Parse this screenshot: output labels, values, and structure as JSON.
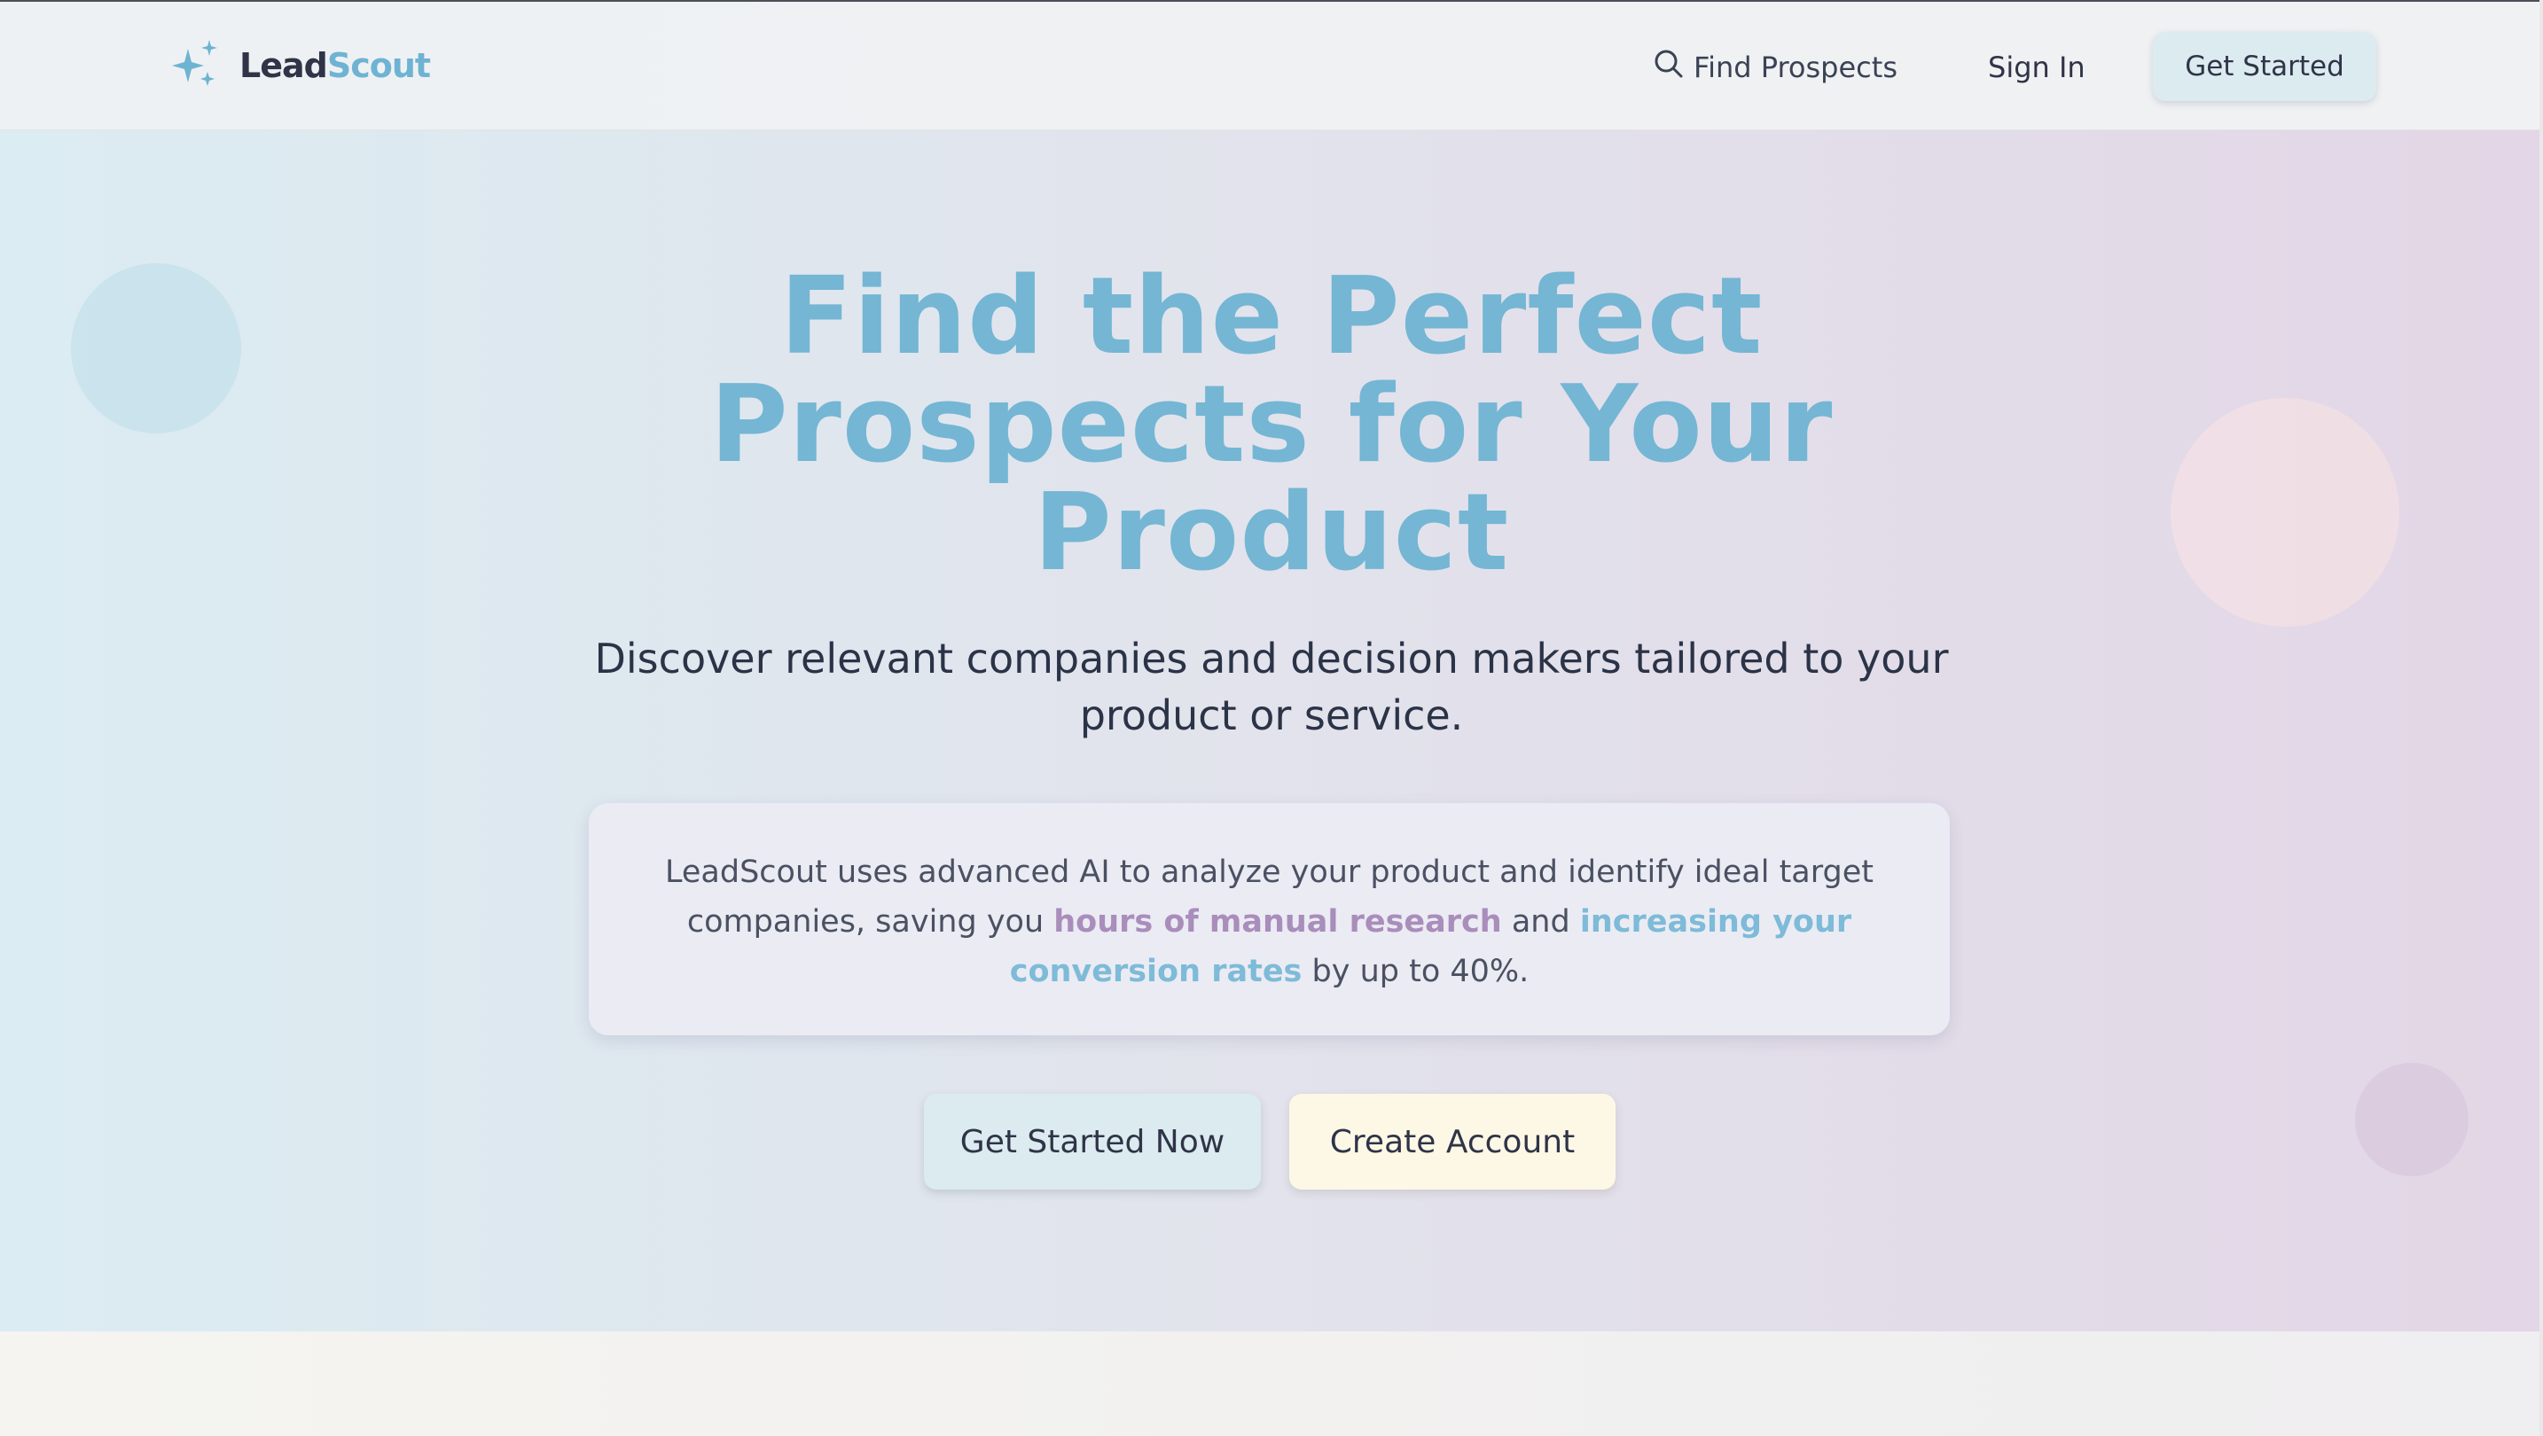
{
  "brand": {
    "name_part1": "Lead",
    "name_part2": "Scout",
    "icon": "sparkles-icon",
    "colors": {
      "dark": "#2f3447",
      "accent": "#6fb3d3"
    }
  },
  "nav": {
    "find_prospects": {
      "label": "Find Prospects",
      "icon": "search-icon"
    },
    "sign_in": "Sign In",
    "get_started": "Get Started"
  },
  "hero": {
    "headline": "Find the Perfect Prospects for Your Product",
    "subheadline": "Discover relevant companies and decision makers tailored to your product or service.",
    "info": {
      "text_start": "LeadScout uses advanced AI to analyze your product and identify ideal target companies, saving you ",
      "highlight1": "hours of manual research",
      "text_mid": " and ",
      "highlight2": "increasing your conversion rates",
      "text_end": " by up to 40%."
    },
    "cta_primary": "Get Started Now",
    "cta_secondary": "Create Account"
  },
  "colors": {
    "headline": "#74b6d4",
    "highlight_purple": "#a98dbb",
    "highlight_blue": "#7dbbd8",
    "button_blue": "#dcebf0",
    "button_cream": "#fdf8e6"
  }
}
